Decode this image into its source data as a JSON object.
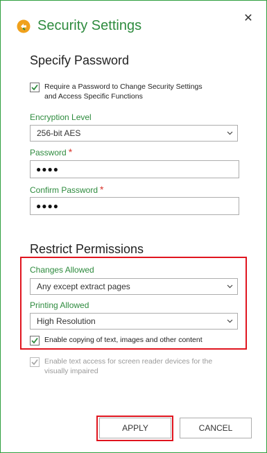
{
  "dialog": {
    "title": "Security Settings",
    "close_glyph": "✕"
  },
  "password_section": {
    "heading": "Specify Password",
    "require_password": {
      "checked": true,
      "line1": "Require a Password to Change Security Settings",
      "line2": "and Access Specific Functions"
    },
    "encryption_label": "Encryption Level",
    "encryption_value": "256-bit AES",
    "password_label": "Password",
    "password_value": "●●●●",
    "confirm_label": "Confirm Password",
    "confirm_value": "●●●●",
    "required_marker": "*"
  },
  "permissions_section": {
    "heading": "Restrict Permissions",
    "changes_label": "Changes Allowed",
    "changes_value": "Any except extract pages",
    "printing_label": "Printing Allowed",
    "printing_value": "High Resolution",
    "enable_copying": {
      "checked": true,
      "label": "Enable copying of text, images and other content"
    },
    "screen_reader": {
      "checked": true,
      "disabled": true,
      "line1": "Enable text access for screen reader devices for the",
      "line2": "visually impaired"
    }
  },
  "buttons": {
    "apply": "APPLY",
    "cancel": "CANCEL"
  },
  "colors": {
    "accent": "#2e8b3e",
    "border": "#2e9e3e",
    "required": "#d9342b",
    "highlight": "#e0141e",
    "icon_orange": "#f0a11c"
  },
  "icons": [
    "app-logo-icon",
    "close-icon",
    "checkmark-icon",
    "chevron-down-icon"
  ]
}
